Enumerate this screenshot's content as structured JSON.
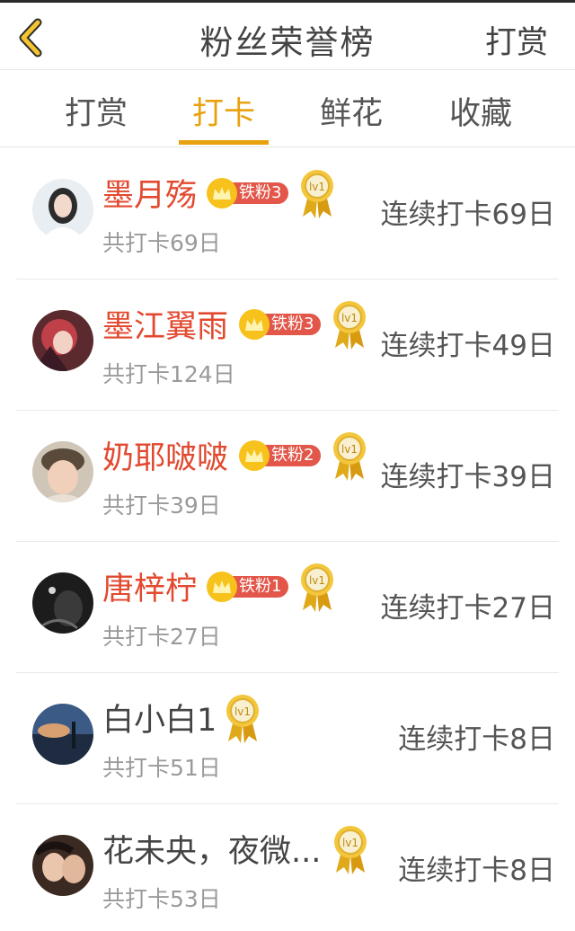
{
  "header": {
    "title": "粉丝荣誉榜",
    "action_label": "打赏"
  },
  "tabs": [
    {
      "label": "打赏",
      "active": false
    },
    {
      "label": "打卡",
      "active": true
    },
    {
      "label": "鲜花",
      "active": false
    },
    {
      "label": "收藏",
      "active": false
    }
  ],
  "colors": {
    "accent": "#e8a10f",
    "name_highlight": "#e2492f",
    "badge_red": "#e2574a",
    "crown_gold": "#f6c21b"
  },
  "fans": [
    {
      "name": "墨月殇",
      "total": "共打卡69日",
      "streak": "连续打卡69日",
      "fan_badge": "铁粉3",
      "level": "lv1",
      "highlight": true
    },
    {
      "name": "墨江翼雨",
      "total": "共打卡124日",
      "streak": "连续打卡49日",
      "fan_badge": "铁粉3",
      "level": "lv1",
      "highlight": true
    },
    {
      "name": "奶耶啵啵",
      "total": "共打卡39日",
      "streak": "连续打卡39日",
      "fan_badge": "铁粉2",
      "level": "lv1",
      "highlight": true
    },
    {
      "name": "唐梓柠",
      "total": "共打卡27日",
      "streak": "连续打卡27日",
      "fan_badge": "铁粉1",
      "level": "lv1",
      "highlight": true
    },
    {
      "name": "白小白1",
      "total": "共打卡51日",
      "streak": "连续打卡8日",
      "fan_badge": null,
      "level": "lv1",
      "highlight": false
    },
    {
      "name": "花未央，夜微...",
      "total": "共打卡53日",
      "streak": "连续打卡8日",
      "fan_badge": null,
      "level": "lv1",
      "highlight": false
    }
  ]
}
